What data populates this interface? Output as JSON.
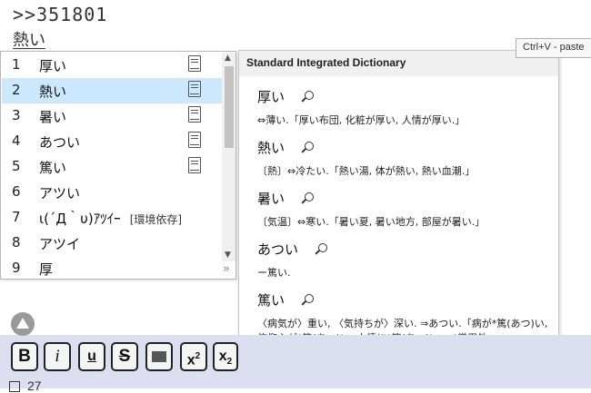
{
  "document": {
    "line1": ">>351801",
    "line2": "熱い"
  },
  "candidates": [
    {
      "num": "1",
      "word": "厚い",
      "hint": "",
      "has_book": true,
      "selected": false
    },
    {
      "num": "2",
      "word": "熱い",
      "hint": "",
      "has_book": true,
      "selected": true
    },
    {
      "num": "3",
      "word": "暑い",
      "hint": "",
      "has_book": true,
      "selected": false
    },
    {
      "num": "4",
      "word": "あつい",
      "hint": "",
      "has_book": true,
      "selected": false
    },
    {
      "num": "5",
      "word": "篤い",
      "hint": "",
      "has_book": true,
      "selected": false
    },
    {
      "num": "6",
      "word": "アツい",
      "hint": "",
      "has_book": false,
      "selected": false
    },
    {
      "num": "7",
      "word": "ι(´Д｀υ)ｱﾂｲｰ",
      "hint": "[環境依存]",
      "has_book": false,
      "selected": false
    },
    {
      "num": "8",
      "word": "アツイ",
      "hint": "",
      "has_book": false,
      "selected": false
    },
    {
      "num": "9",
      "word": "厚",
      "hint": "",
      "has_book": false,
      "selected": false
    }
  ],
  "candidate_scroll": {
    "up": "▲",
    "down": "▼",
    "expand": "»"
  },
  "dictionary": {
    "title": "Standard Integrated Dictionary",
    "entries": [
      {
        "head": "厚い",
        "def": "⇔薄い.「厚い布団, 化粧が厚い, 人情が厚い.」"
      },
      {
        "head": "熱い",
        "def": "〔熱〕⇔冷たい.「熱い湯, 体が熱い, 熱い血潮.」"
      },
      {
        "head": "暑い",
        "def": "〔気温〕⇔寒い.「暑い夏, 暑い地方, 部屋が暑い.」"
      },
      {
        "head": "あつい",
        "def": "ー篤い."
      },
      {
        "head": "篤い",
        "def": "〈病気が〉重い, 〈気持ちが〉深い. ⇒あつい.「病が*篤(あつ)い, 信仰心が*篤(あつ)い, 人情に*篤(あつ)い.」*常用外"
      }
    ],
    "grip": "⠿"
  },
  "tooltip": "Ctrl+V - paste",
  "toolbar": {
    "bold": "B",
    "italic": "i",
    "underline": "u",
    "strike": "S",
    "sup_base": "x",
    "sup_mark": "2",
    "sub_base": "x",
    "sub_mark": "2"
  },
  "bottom_text": "27"
}
